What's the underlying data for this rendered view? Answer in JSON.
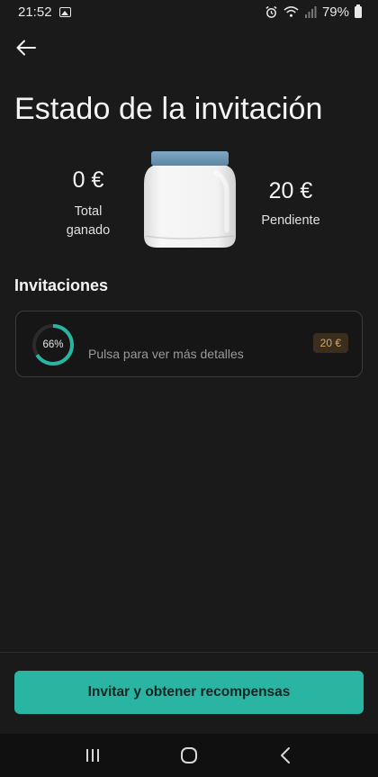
{
  "status_bar": {
    "time": "21:52",
    "battery": "79%"
  },
  "header": {
    "title": "Estado de la invitación"
  },
  "stats": {
    "earned_value": "0 €",
    "earned_label_line1": "Total",
    "earned_label_line2": "ganado",
    "pending_value": "20 €",
    "pending_label": "Pendiente"
  },
  "invitations": {
    "section_title": "Invitaciones",
    "progress_percent": 66,
    "progress_label": "66%",
    "hint": "Pulsa para ver más detalles",
    "amount": "20 €"
  },
  "cta": {
    "label": "Invitar y obtener recompensas"
  },
  "colors": {
    "accent": "#2ab5a3",
    "background": "#1a1a1a",
    "badge_bg": "#3a2f1e",
    "badge_text": "#d9a85a"
  },
  "icons": {
    "back": "arrow-left-icon",
    "nav_recents": "recents-icon",
    "nav_home": "home-icon",
    "nav_back": "chevron-left-icon"
  }
}
